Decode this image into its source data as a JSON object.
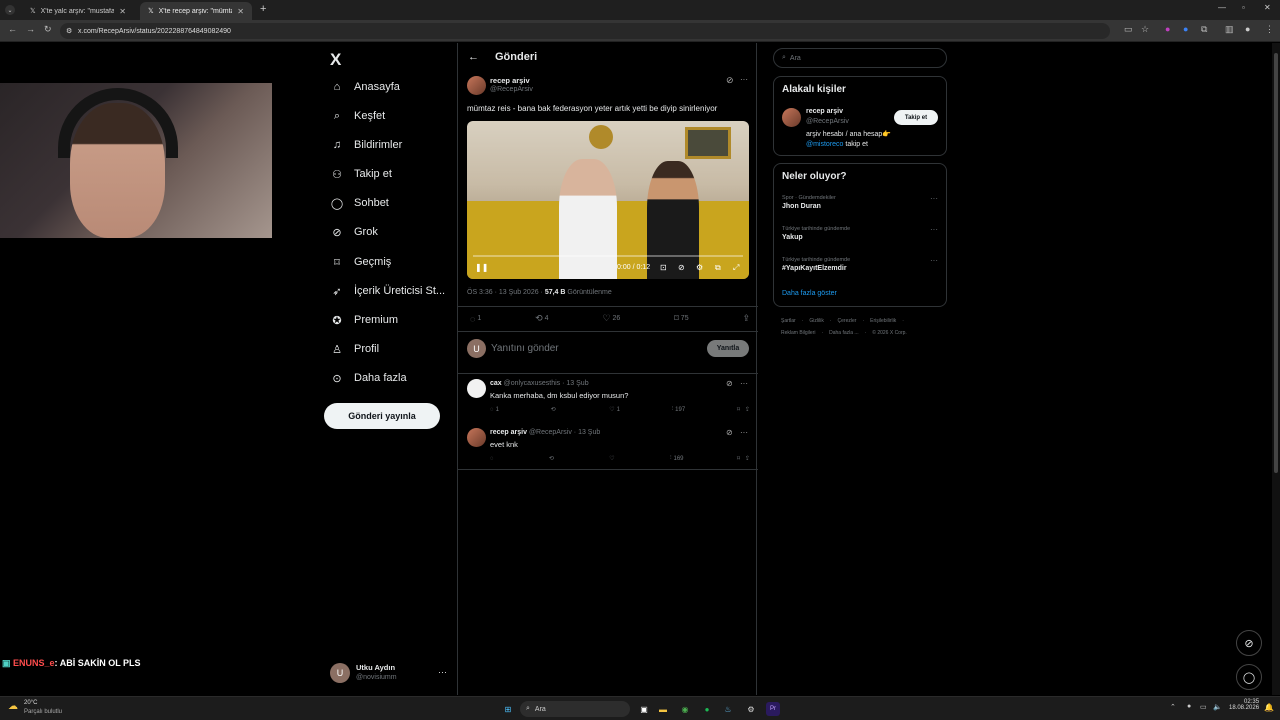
{
  "browser": {
    "tabs": [
      {
        "title": "X'te yalc arşiv: \"mustafa sözen k",
        "active": false
      },
      {
        "title": "X'te recep arşiv: \"mümtaz reis - b",
        "active": true
      }
    ],
    "url": "x.com/RecepArsiv/status/2022288764849082490"
  },
  "overlay": {
    "chat_user": "ENUNS_e",
    "chat_message": ": ABİ SAKİN OL PLS"
  },
  "sidebar": {
    "logo": "X",
    "items": [
      {
        "label": "Anasayfa",
        "icon": "home-icon"
      },
      {
        "label": "Keşfet",
        "icon": "search-icon"
      },
      {
        "label": "Bildirimler",
        "icon": "bell-icon"
      },
      {
        "label": "Takip et",
        "icon": "add-user-icon"
      },
      {
        "label": "Sohbet",
        "icon": "chat-icon"
      },
      {
        "label": "Grok",
        "icon": "grok-icon"
      },
      {
        "label": "Geçmiş",
        "icon": "bookmark-icon"
      },
      {
        "label": "İçerik Üreticisi St...",
        "icon": "rocket-icon"
      },
      {
        "label": "Premium",
        "icon": "premium-icon"
      },
      {
        "label": "Profil",
        "icon": "person-icon"
      },
      {
        "label": "Daha fazla",
        "icon": "more-icon"
      }
    ],
    "post_button": "Gönderi yayınla",
    "account": {
      "name": "Utku Aydın",
      "handle": "@novisiumm",
      "initial": "U"
    }
  },
  "main": {
    "header": "Gönderi",
    "post": {
      "author": "recep arşiv",
      "handle": "@RecepArsiv",
      "text": "mümtaz reis - bana bak federasyon yeter artık yetti be diyip sinirleniyor",
      "video_time": "0:00 / 0:12",
      "video_progress": 0.0,
      "meta_time": "ÖS 3:36 · 13 Şub 2026 · ",
      "views": "57,4 B",
      "views_label": " Görüntülenme",
      "replies": "1",
      "reposts": "4",
      "likes": "26",
      "bookmarks": "75"
    },
    "reply_box": {
      "placeholder": "Yanıtını gönder",
      "button": "Yanıtla",
      "initial": "U"
    },
    "replies": [
      {
        "author": "cax",
        "handle": "@onlycaxusesthis",
        "date": "· 13 Şub",
        "text": "Kanka merhaba, dm ksbul ediyor musun?",
        "replies": "1",
        "reposts": "",
        "likes": "1",
        "views": "197"
      },
      {
        "author": "recep arşiv",
        "handle": "@RecepArsiv",
        "date": "· 13 Şub",
        "text": "evet knk",
        "replies": "",
        "reposts": "",
        "likes": "",
        "views": "169"
      }
    ]
  },
  "right": {
    "search_placeholder": "Ara",
    "related_title": "Alakalı kişiler",
    "related": {
      "name": "recep arşiv",
      "handle": "@RecepArsiv",
      "bio_1": "arşiv hesabı / ana hesap👉",
      "bio_link": "@mistoreco",
      "bio_2": " takip et",
      "follow": "Takip et"
    },
    "trends_title": "Neler oluyor?",
    "trends": [
      {
        "category": "Spor · Gündemdekiler",
        "name": "Jhon Duran"
      },
      {
        "category": "Türkiye tarihinde gündemde",
        "name": "Yakup"
      },
      {
        "category": "Türkiye tarihinde gündemde",
        "name": "#YapıKayıtElzemdir"
      }
    ],
    "show_more": "Daha fazla göster",
    "footer_1": [
      "Şartlar",
      "Gizlilik",
      "Çerezler",
      "Erişilebilirlik"
    ],
    "footer_2": [
      "Reklam Bilgileri",
      "Daha fazla ...",
      "© 2026 X Corp."
    ]
  },
  "taskbar": {
    "weather_temp": "20°C",
    "weather_desc": "Parçalı bulutlu",
    "search": "Ara",
    "time": "02:35",
    "date": "18.08.2026"
  },
  "colors": {
    "accent": "#1d9bf0",
    "background": "#000000",
    "border": "#2f3336"
  }
}
